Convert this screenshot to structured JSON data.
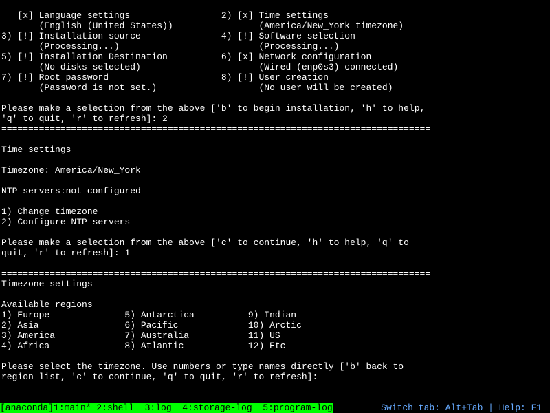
{
  "hub": {
    "items": [
      {
        "n": "",
        "mark": "[x]",
        "title": "Language settings",
        "sub": "(English (United States))"
      },
      {
        "n": "2)",
        "mark": "[x]",
        "title": "Time settings",
        "sub": "(America/New_York timezone)"
      },
      {
        "n": "3)",
        "mark": "[!]",
        "title": "Installation source",
        "sub": "(Processing...)"
      },
      {
        "n": "4)",
        "mark": "[!]",
        "title": "Software selection",
        "sub": "(Processing...)"
      },
      {
        "n": "5)",
        "mark": "[!]",
        "title": "Installation Destination",
        "sub": "(No disks selected)"
      },
      {
        "n": "6)",
        "mark": "[x]",
        "title": "Network configuration",
        "sub": "(Wired (enp0s3) connected)"
      },
      {
        "n": "7)",
        "mark": "[!]",
        "title": "Root password",
        "sub": "(Password is not set.)"
      },
      {
        "n": "8)",
        "mark": "[!]",
        "title": "User creation",
        "sub": "(No user will be created)"
      }
    ],
    "prompt_lines": [
      "Please make a selection from the above ['b' to begin installation, 'h' to help,",
      "'q' to quit, 'r' to refresh]: "
    ],
    "prompt_input": "2"
  },
  "divider": "================================================================================",
  "time": {
    "title": "Time settings",
    "blank": "",
    "tz_line": "Timezone: America/New_York",
    "ntp_line": "NTP servers:not configured",
    "opts": [
      "1) Change timezone",
      "2) Configure NTP servers"
    ],
    "prompt_lines": [
      "Please make a selection from the above ['c' to continue, 'h' to help, 'q' to",
      "quit, 'r' to refresh]: "
    ],
    "prompt_input": "1"
  },
  "tz": {
    "title": "Timezone settings",
    "blank": "",
    "avail": "Available regions",
    "regions": [
      [
        "1) Europe",
        "5) Antarctica",
        "9) Indian"
      ],
      [
        "2) Asia",
        "6) Pacific",
        "10) Arctic"
      ],
      [
        "3) America",
        "7) Australia",
        "11) US"
      ],
      [
        "4) Africa",
        "8) Atlantic",
        "12) Etc"
      ]
    ],
    "prompt_lines": [
      "Please select the timezone. Use numbers or type names directly ['b' back to",
      "region list, 'c' to continue, 'q' to quit, 'r' to refresh]: "
    ],
    "prompt_input": ""
  },
  "status": {
    "left": "[anaconda]1:main* 2:shell  3:log  4:storage-log  5:program-log",
    "right": "Switch tab: Alt+Tab | Help: F1 "
  },
  "colw": {
    "hubLeft": 41,
    "regA": 23,
    "regB": 23
  }
}
